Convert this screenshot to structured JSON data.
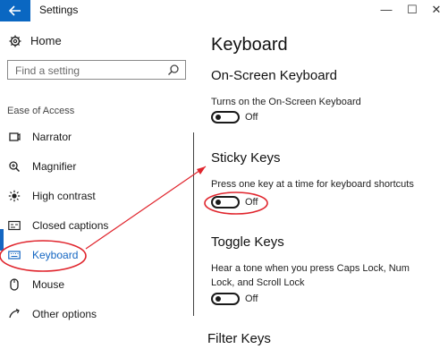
{
  "window": {
    "title": "Settings",
    "back_icon": "arrow-left-icon",
    "minimize_label": "—",
    "maximize_label": "☐",
    "close_label": "✕"
  },
  "sidebar": {
    "home_label": "Home",
    "search_placeholder": "Find a setting",
    "section_label": "Ease of Access",
    "items": [
      {
        "label": "Narrator",
        "icon": "narrator-icon"
      },
      {
        "label": "Magnifier",
        "icon": "magnifier-icon"
      },
      {
        "label": "High contrast",
        "icon": "high-contrast-icon"
      },
      {
        "label": "Closed captions",
        "icon": "closed-captions-icon"
      },
      {
        "label": "Keyboard",
        "icon": "keyboard-icon",
        "selected": true
      },
      {
        "label": "Mouse",
        "icon": "mouse-icon"
      },
      {
        "label": "Other options",
        "icon": "other-options-icon"
      }
    ]
  },
  "main": {
    "page_title": "Keyboard",
    "on_screen": {
      "title": "On-Screen Keyboard",
      "description": "Turns on the On-Screen Keyboard",
      "toggle_state": "Off"
    },
    "sticky": {
      "title": "Sticky Keys",
      "description": "Press one key at a time for keyboard shortcuts",
      "toggle_state": "Off"
    },
    "toggle_keys": {
      "title": "Toggle Keys",
      "description": "Hear a tone when you press Caps Lock, Num Lock, and Scroll Lock",
      "toggle_state": "Off"
    },
    "filter_keys": {
      "title": "Filter Keys"
    }
  },
  "colors": {
    "accent": "#1466c2",
    "annotation": "#e0242c"
  }
}
